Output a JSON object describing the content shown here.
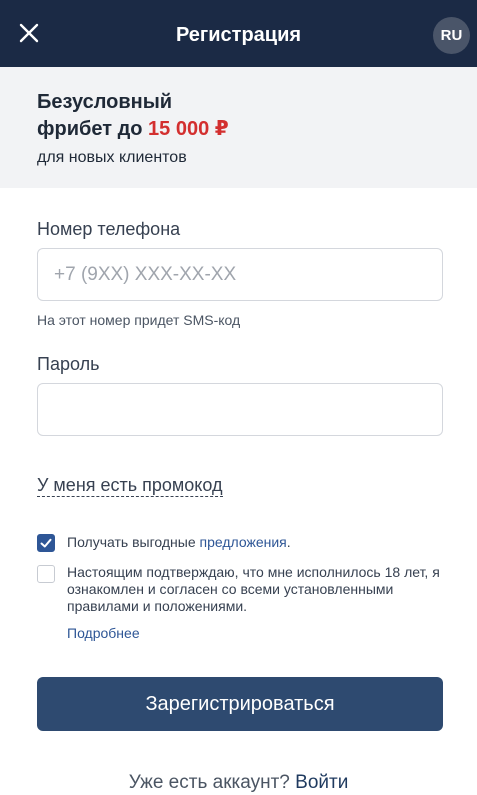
{
  "header": {
    "title": "Регистрация",
    "lang": "RU"
  },
  "promo": {
    "title_part1": "Безусловный",
    "title_part2": "фрибет до ",
    "amount": "15 000 ₽",
    "subtitle": "для новых клиентов"
  },
  "form": {
    "phone_label": "Номер телефона",
    "phone_placeholder": "+7 (9XX) XXX-XX-XX",
    "phone_hint": "На этот номер придет SMS-код",
    "password_label": "Пароль",
    "password_value": "",
    "promo_link": "У меня есть промокод"
  },
  "consents": {
    "offers_checked": true,
    "offers_text": "Получать выгодные ",
    "offers_link": "предложения",
    "offers_suffix": ".",
    "age_checked": false,
    "age_text": "Настоящим подтверждаю, что мне исполнилось 18 лет, я ознакомлен и согласен со всеми установленными правилами и положениями.",
    "more_link": "Подробнее"
  },
  "actions": {
    "register_label": "Зарегистрироваться",
    "have_account_text": "Уже есть аккаунт? ",
    "login_link": "Войти"
  },
  "colors": {
    "header_bg": "#1b2a45",
    "accent_red": "#d32f2f",
    "accent_blue": "#2e5696",
    "button_bg": "#2e4a70"
  },
  "icons": {
    "close": "close-icon",
    "check": "check-icon"
  }
}
